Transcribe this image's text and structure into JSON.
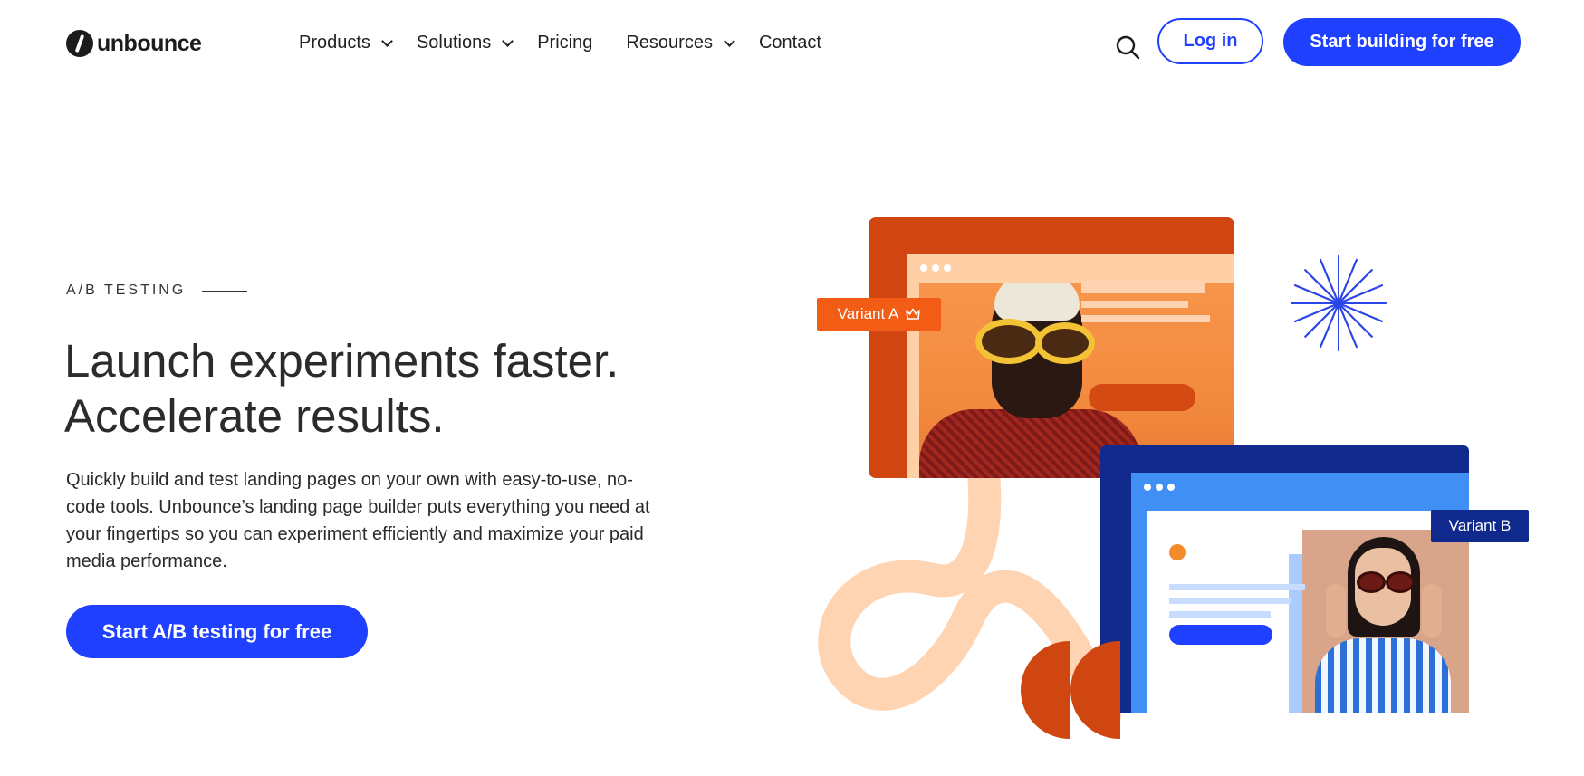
{
  "brand": {
    "name": "unbounce"
  },
  "nav": {
    "items": [
      {
        "label": "Products",
        "has_dropdown": true
      },
      {
        "label": "Solutions",
        "has_dropdown": true
      },
      {
        "label": "Pricing",
        "has_dropdown": false
      },
      {
        "label": "Resources",
        "has_dropdown": true
      },
      {
        "label": "Contact",
        "has_dropdown": false
      }
    ],
    "search_icon": "search-icon",
    "login_label": "Log in",
    "start_label": "Start building for free"
  },
  "hero": {
    "eyebrow": "A/B TESTING",
    "headline_line1": "Launch experiments faster.",
    "headline_line2": "Accelerate results.",
    "description": "Quickly build and test landing pages on your own with easy-to-use, no-code tools. Unbounce’s landing page builder puts everything you need at your fingertips so you can experiment efficiently and maximize your paid media performance.",
    "cta_label": "Start A/B testing for free"
  },
  "illustration": {
    "variant_a_label": "Variant A",
    "variant_a_icon": "crown-icon",
    "variant_b_label": "Variant B"
  },
  "colors": {
    "primary": "#1f40ff",
    "orange": "#d04510",
    "navy": "#12298d",
    "peach": "#ffcfa6"
  }
}
